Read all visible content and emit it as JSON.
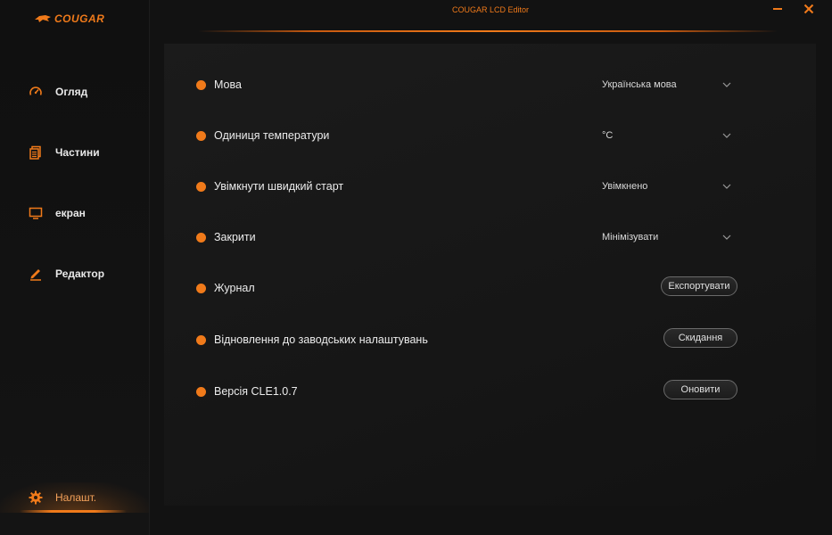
{
  "app": {
    "title": "COUGAR LCD Editor",
    "brand": "COUGAR",
    "accent_color": "#f07a1a"
  },
  "window_controls": [
    {
      "name": "minimize",
      "icon": "minimize-icon"
    },
    {
      "name": "close",
      "icon": "close-icon"
    }
  ],
  "sidebar": {
    "items": [
      {
        "label": "Огляд",
        "icon": "speedometer-icon"
      },
      {
        "label": "Частини",
        "icon": "parts-icon"
      },
      {
        "label": "екран",
        "icon": "monitor-icon"
      },
      {
        "label": "Редактор",
        "icon": "pen-icon"
      },
      {
        "label": "Налашт.",
        "icon": "gear-icon",
        "active": true
      }
    ]
  },
  "settings": {
    "language": {
      "label": "Мова",
      "value": "Українська мова"
    },
    "temperature_unit": {
      "label": "Одиниця температури",
      "value": "°C"
    },
    "quick_start": {
      "label": "Увімкнути швидкий старт",
      "value": "Увімкнено"
    },
    "on_close": {
      "label": "Закрити",
      "value": "Мінімізувати"
    },
    "log": {
      "label": "Журнал",
      "button": "Експортувати"
    },
    "factory_reset": {
      "label": "Відновлення до заводських налаштувань",
      "button": "Скидання"
    },
    "version": {
      "label": "Версія CLE1.0.7",
      "button": "Оновити"
    }
  }
}
